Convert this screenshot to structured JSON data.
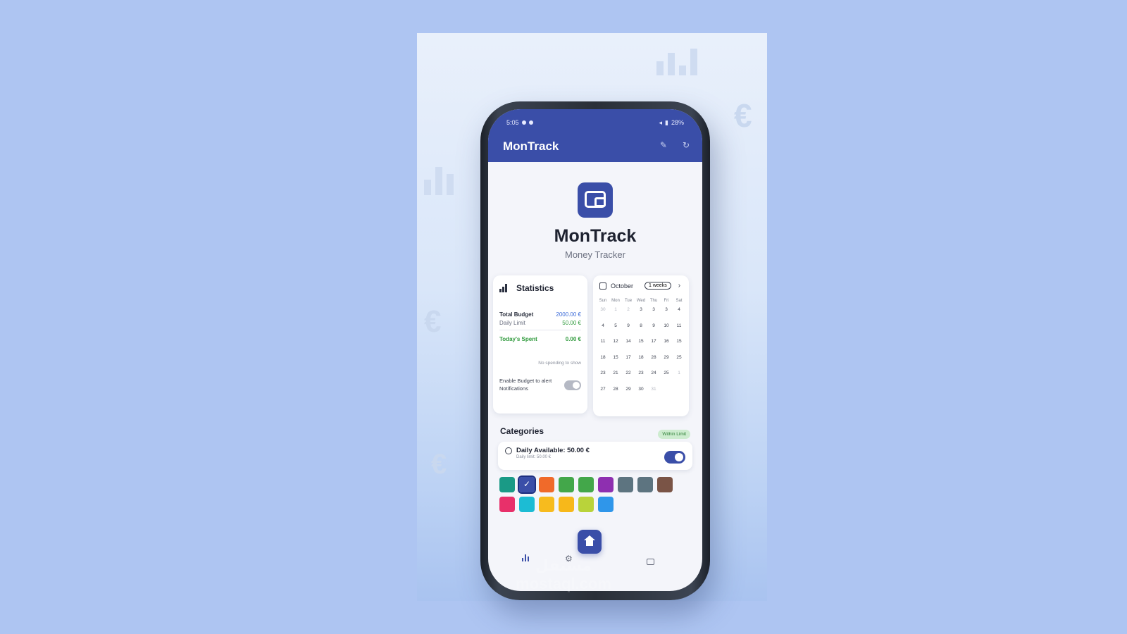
{
  "status_bar": {
    "time": "5:05",
    "battery": "28%"
  },
  "appbar": {
    "title": "MonTrack"
  },
  "hero": {
    "title": "MonTrack",
    "subtitle": "Money Tracker"
  },
  "statistics": {
    "title": "Statistics",
    "total_budget_label": "Total Budget",
    "total_budget_value": "2000.00 €",
    "daily_limit_label": "Daily Limit",
    "daily_limit_value": "50.00 €",
    "todays_spent_label": "Today's Spent",
    "todays_spent_value": "0.00 €",
    "empty_note": "No spending to show",
    "notif_label": "Enable Budget to alert Notifications",
    "notif_enabled": false
  },
  "calendar": {
    "month": "October",
    "range": "1 weeks",
    "weekdays": [
      "Sun",
      "Mon",
      "Tue",
      "Wed",
      "Thu",
      "Fri",
      "Sat"
    ],
    "days": [
      {
        "d": "30",
        "dim": true
      },
      {
        "d": "1",
        "dim": true
      },
      {
        "d": "2",
        "dim": true
      },
      {
        "d": "3"
      },
      {
        "d": "3"
      },
      {
        "d": "3"
      },
      {
        "d": "4"
      },
      {
        "d": "4"
      },
      {
        "d": "5"
      },
      {
        "d": "9"
      },
      {
        "d": "8"
      },
      {
        "d": "9"
      },
      {
        "d": "10"
      },
      {
        "d": "11"
      },
      {
        "d": "11"
      },
      {
        "d": "12"
      },
      {
        "d": "14"
      },
      {
        "d": "15"
      },
      {
        "d": "17"
      },
      {
        "d": "16"
      },
      {
        "d": "15"
      },
      {
        "d": "18"
      },
      {
        "d": "15"
      },
      {
        "d": "17"
      },
      {
        "d": "18"
      },
      {
        "d": "28"
      },
      {
        "d": "29"
      },
      {
        "d": "25"
      },
      {
        "d": "23"
      },
      {
        "d": "21"
      },
      {
        "d": "22"
      },
      {
        "d": "23"
      },
      {
        "d": "24"
      },
      {
        "d": "25"
      },
      {
        "d": "1",
        "dim": true
      },
      {
        "d": "27"
      },
      {
        "d": "28"
      },
      {
        "d": "29"
      },
      {
        "d": "30"
      },
      {
        "d": "31",
        "dim": true
      },
      {
        "d": ""
      },
      {
        "d": ""
      }
    ]
  },
  "categories": {
    "title": "Categories",
    "badge": "Within Limit",
    "daily_available": "Daily Available: 50.00 €",
    "daily_sub": "Daily limit: 50.00 €",
    "daily_enabled": true,
    "swatches": [
      {
        "color": "#1a9a86"
      },
      {
        "color": "#3a4ea8",
        "selected": true
      },
      {
        "color": "#f06a2a"
      },
      {
        "color": "#43a74a"
      },
      {
        "color": "#43a74a"
      },
      {
        "color": "#8e2fb0"
      },
      {
        "color": "#5d7480"
      },
      {
        "color": "#5d7480"
      },
      {
        "color": "#7a5446"
      },
      {
        "color": "#e8306a"
      },
      {
        "color": "#1cbcd4"
      },
      {
        "color": "#f7bb1e"
      },
      {
        "color": "#f7b81a"
      },
      {
        "color": "#b9d33a"
      },
      {
        "color": "#2f96ea"
      }
    ]
  },
  "watermark": "مستقل mostaql.com",
  "colors": {
    "primary": "#3a4ea8",
    "background": "#aec5f2"
  }
}
